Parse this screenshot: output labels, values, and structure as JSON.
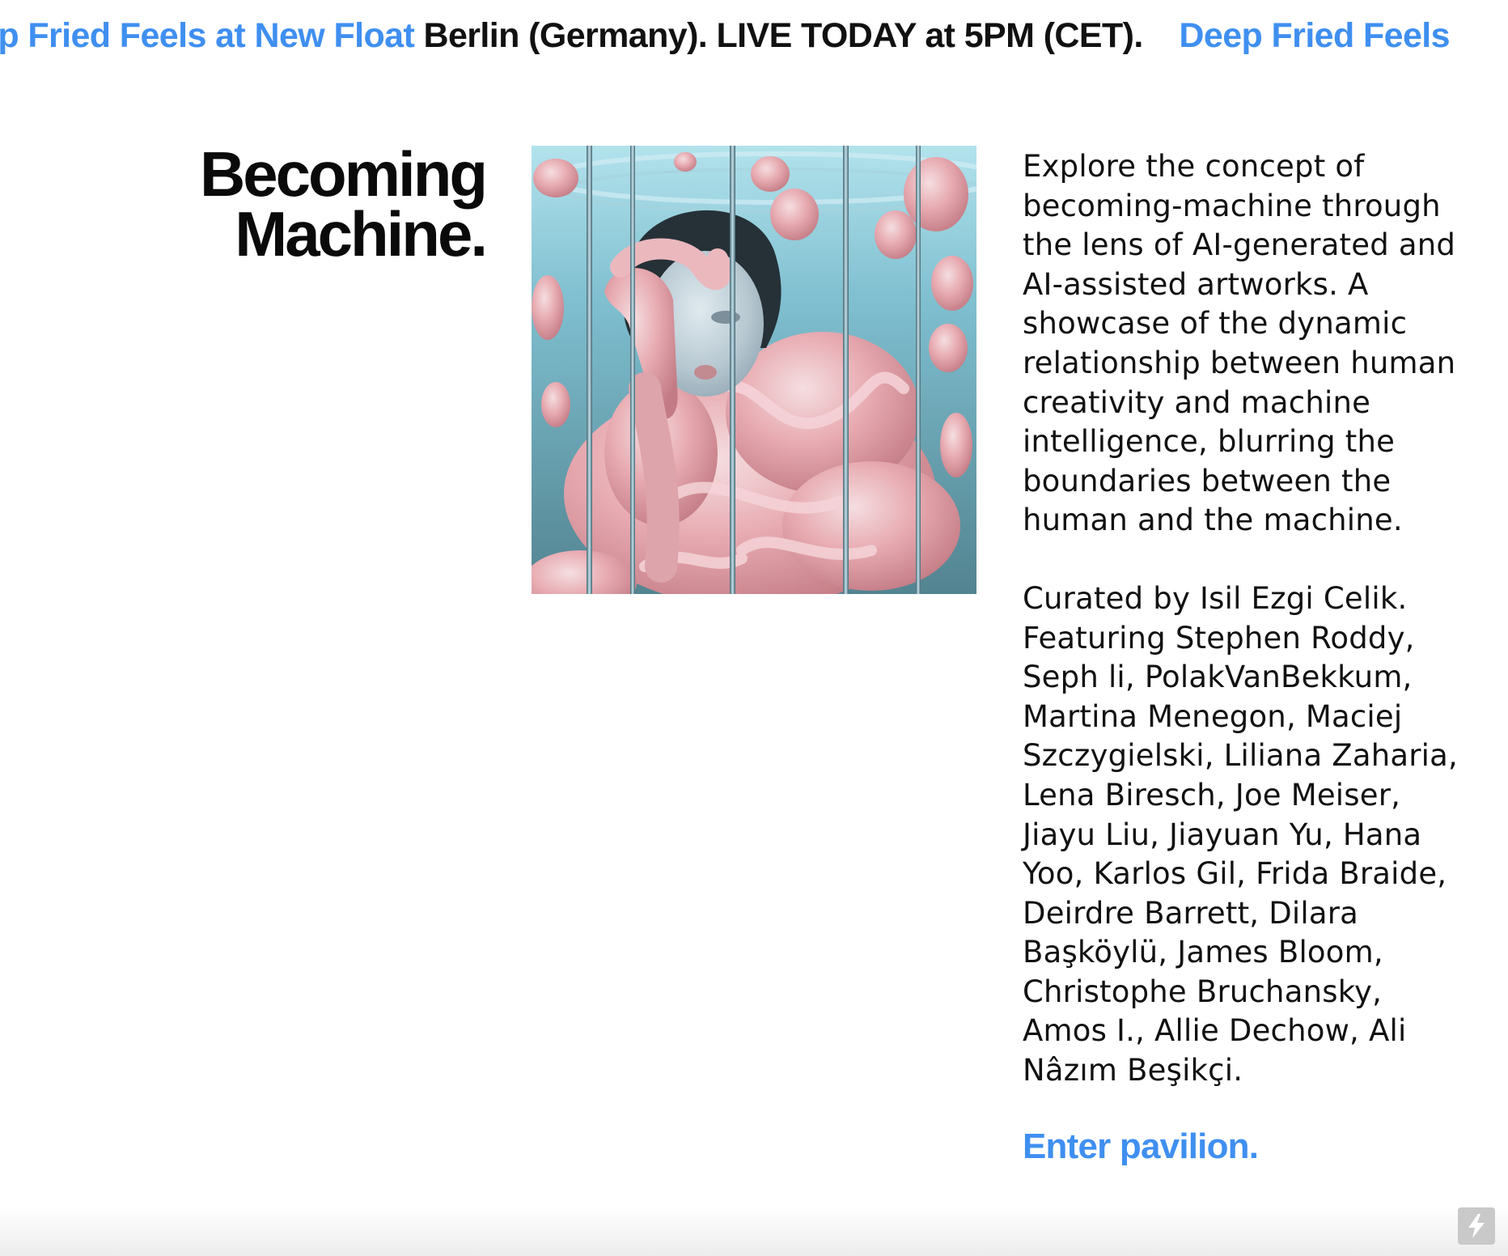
{
  "banner": {
    "segments": [
      {
        "link": "ep Fried Feels at New Float",
        "text": "Berlin (Germany).  LIVE TODAY at 5PM (CET)."
      },
      {
        "link": "Deep Fried Feels",
        "text": ""
      }
    ]
  },
  "exhibition": {
    "title_line1": "Becoming",
    "title_line2": "Machine.",
    "description": "Explore the concept of becoming-machine through the lens of AI-generated and AI-assisted artworks. A showcase of the dynamic relationship between human creativity and machine intelligence, blurring the boundaries between the human and the machine.",
    "credits": "Curated by Isil Ezgi Celik. Featuring Stephen Roddy, Seph li, PolakVanBekkum, Martina Menegon, Maciej Szczygielski, Liliana Zaharia, Lena Biresch, Joe Meiser, Jiayu Liu, Jiayuan Yu, Hana Yoo, Karlos Gil, Frida Braide, Deirdre Barrett, Dilara Başköylü, James Bloom, Christophe Bruchansky, Amos I., Allie Dechow, Ali Nâzım Beşikçi.",
    "cta_label": "Enter pavilion."
  },
  "icons": {
    "corner_badge": "lightning-bolt-icon"
  },
  "colors": {
    "accent": "#3f8ff0",
    "text": "#0a0a0a",
    "background": "#ffffff"
  }
}
